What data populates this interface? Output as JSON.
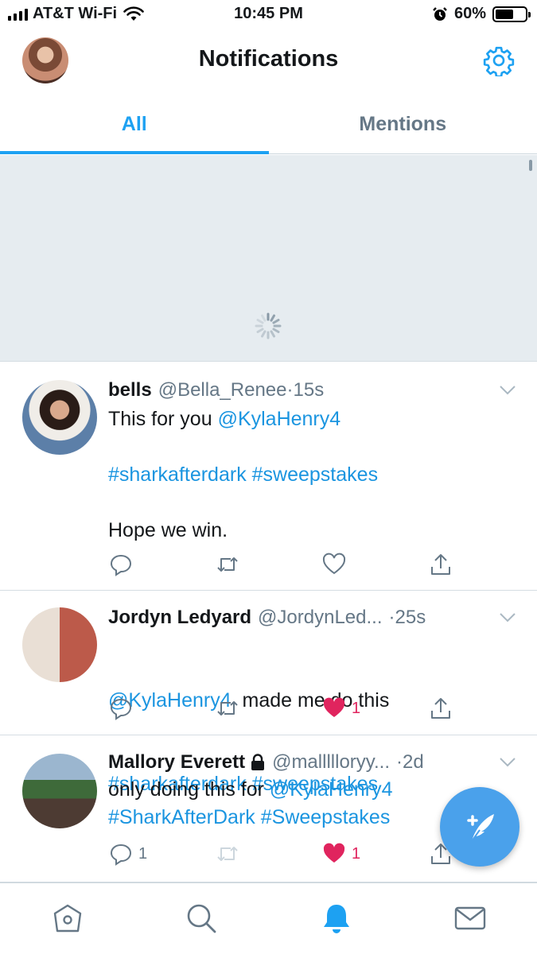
{
  "status_bar": {
    "carrier": "AT&T Wi-Fi",
    "time": "10:45 PM",
    "battery_percent": "60%",
    "battery_level": 0.6,
    "icons": [
      "signal-icon",
      "wifi-icon",
      "alarm-icon",
      "battery-icon"
    ]
  },
  "header": {
    "title": "Notifications",
    "settings_icon": "gear-icon"
  },
  "tabs": [
    {
      "label": "All",
      "active": true
    },
    {
      "label": "Mentions",
      "active": false
    }
  ],
  "tweets": [
    {
      "name": "bells",
      "handle": "@Bella_Renee",
      "separator": "·",
      "time": "15s",
      "lines": {
        "l1_plain": "This for you ",
        "l1_link": "@KylaHenry4",
        "l2_link": "#sharkafterdark #sweepstakes",
        "l3_plain": "Hope we win."
      },
      "actions": {
        "reply_count": "",
        "retweet_count": "",
        "like_count": "",
        "liked": false
      }
    },
    {
      "name": "Jordyn Ledyard",
      "handle": "@JordynLed...",
      "separator": "·",
      "time": "25s",
      "lines": {
        "l1_link": "@KylaHenry4",
        "l1_plain": "  made me do this",
        "l2_link": "#sharkafterdark #sweepstakes"
      },
      "actions": {
        "reply_count": "",
        "retweet_count": "",
        "like_count": "1",
        "liked": true
      }
    },
    {
      "name": "Mallory Everett",
      "handle": "@mallllloryy...",
      "separator": "·",
      "time": "2d",
      "protected": true,
      "lines": {
        "l1_plain": "only doing this for ",
        "l1_link": "@KylaHenry4",
        "l2_link": "#SharkAfterDark #Sweepstakes"
      },
      "actions": {
        "reply_count": "1",
        "retweet_count": "",
        "like_count": "1",
        "liked": true
      }
    }
  ],
  "tab_bar": [
    "home-icon",
    "search-icon",
    "notifications-bell-icon",
    "messages-icon"
  ],
  "colors": {
    "accent": "#1da1f2",
    "link": "#1b95e0",
    "like": "#e0245e",
    "muted": "#657786",
    "loading_bg": "#e6ecf0"
  }
}
